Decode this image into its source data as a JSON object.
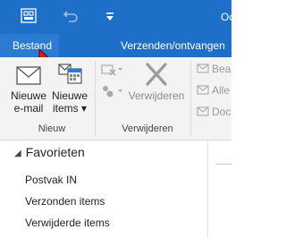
{
  "window": {
    "title_partial": "Oc"
  },
  "quick_access": {
    "save_icon": "send-receive-all-icon",
    "undo_icon": "undo-icon",
    "customize_icon": "customize-quick-access-icon"
  },
  "tabs": [
    {
      "label": "Bestand",
      "active": true
    },
    {
      "label": "Verzenden/ontvangen"
    }
  ],
  "ribbon": {
    "groups": {
      "new": {
        "label": "Nieuw",
        "new_mail": {
          "line1": "Nieuwe",
          "line2": "e-mail"
        },
        "new_items": {
          "line1": "Nieuwe",
          "line2": "items ▾"
        }
      },
      "delete": {
        "label": "Verwijderen",
        "delete_button": "Verwijderen"
      },
      "respond": {
        "items": [
          "Bea",
          "Alle",
          "Doc"
        ]
      }
    }
  },
  "navigation": {
    "favorites_header": "Favorieten",
    "items": [
      "Postvak IN",
      "Verzonden items",
      "Verwijderde items"
    ]
  },
  "colors": {
    "title_bar": "#1e6fc8",
    "ribbon_bg": "#f3f3f3",
    "disabled_text": "#8a8a8a"
  }
}
